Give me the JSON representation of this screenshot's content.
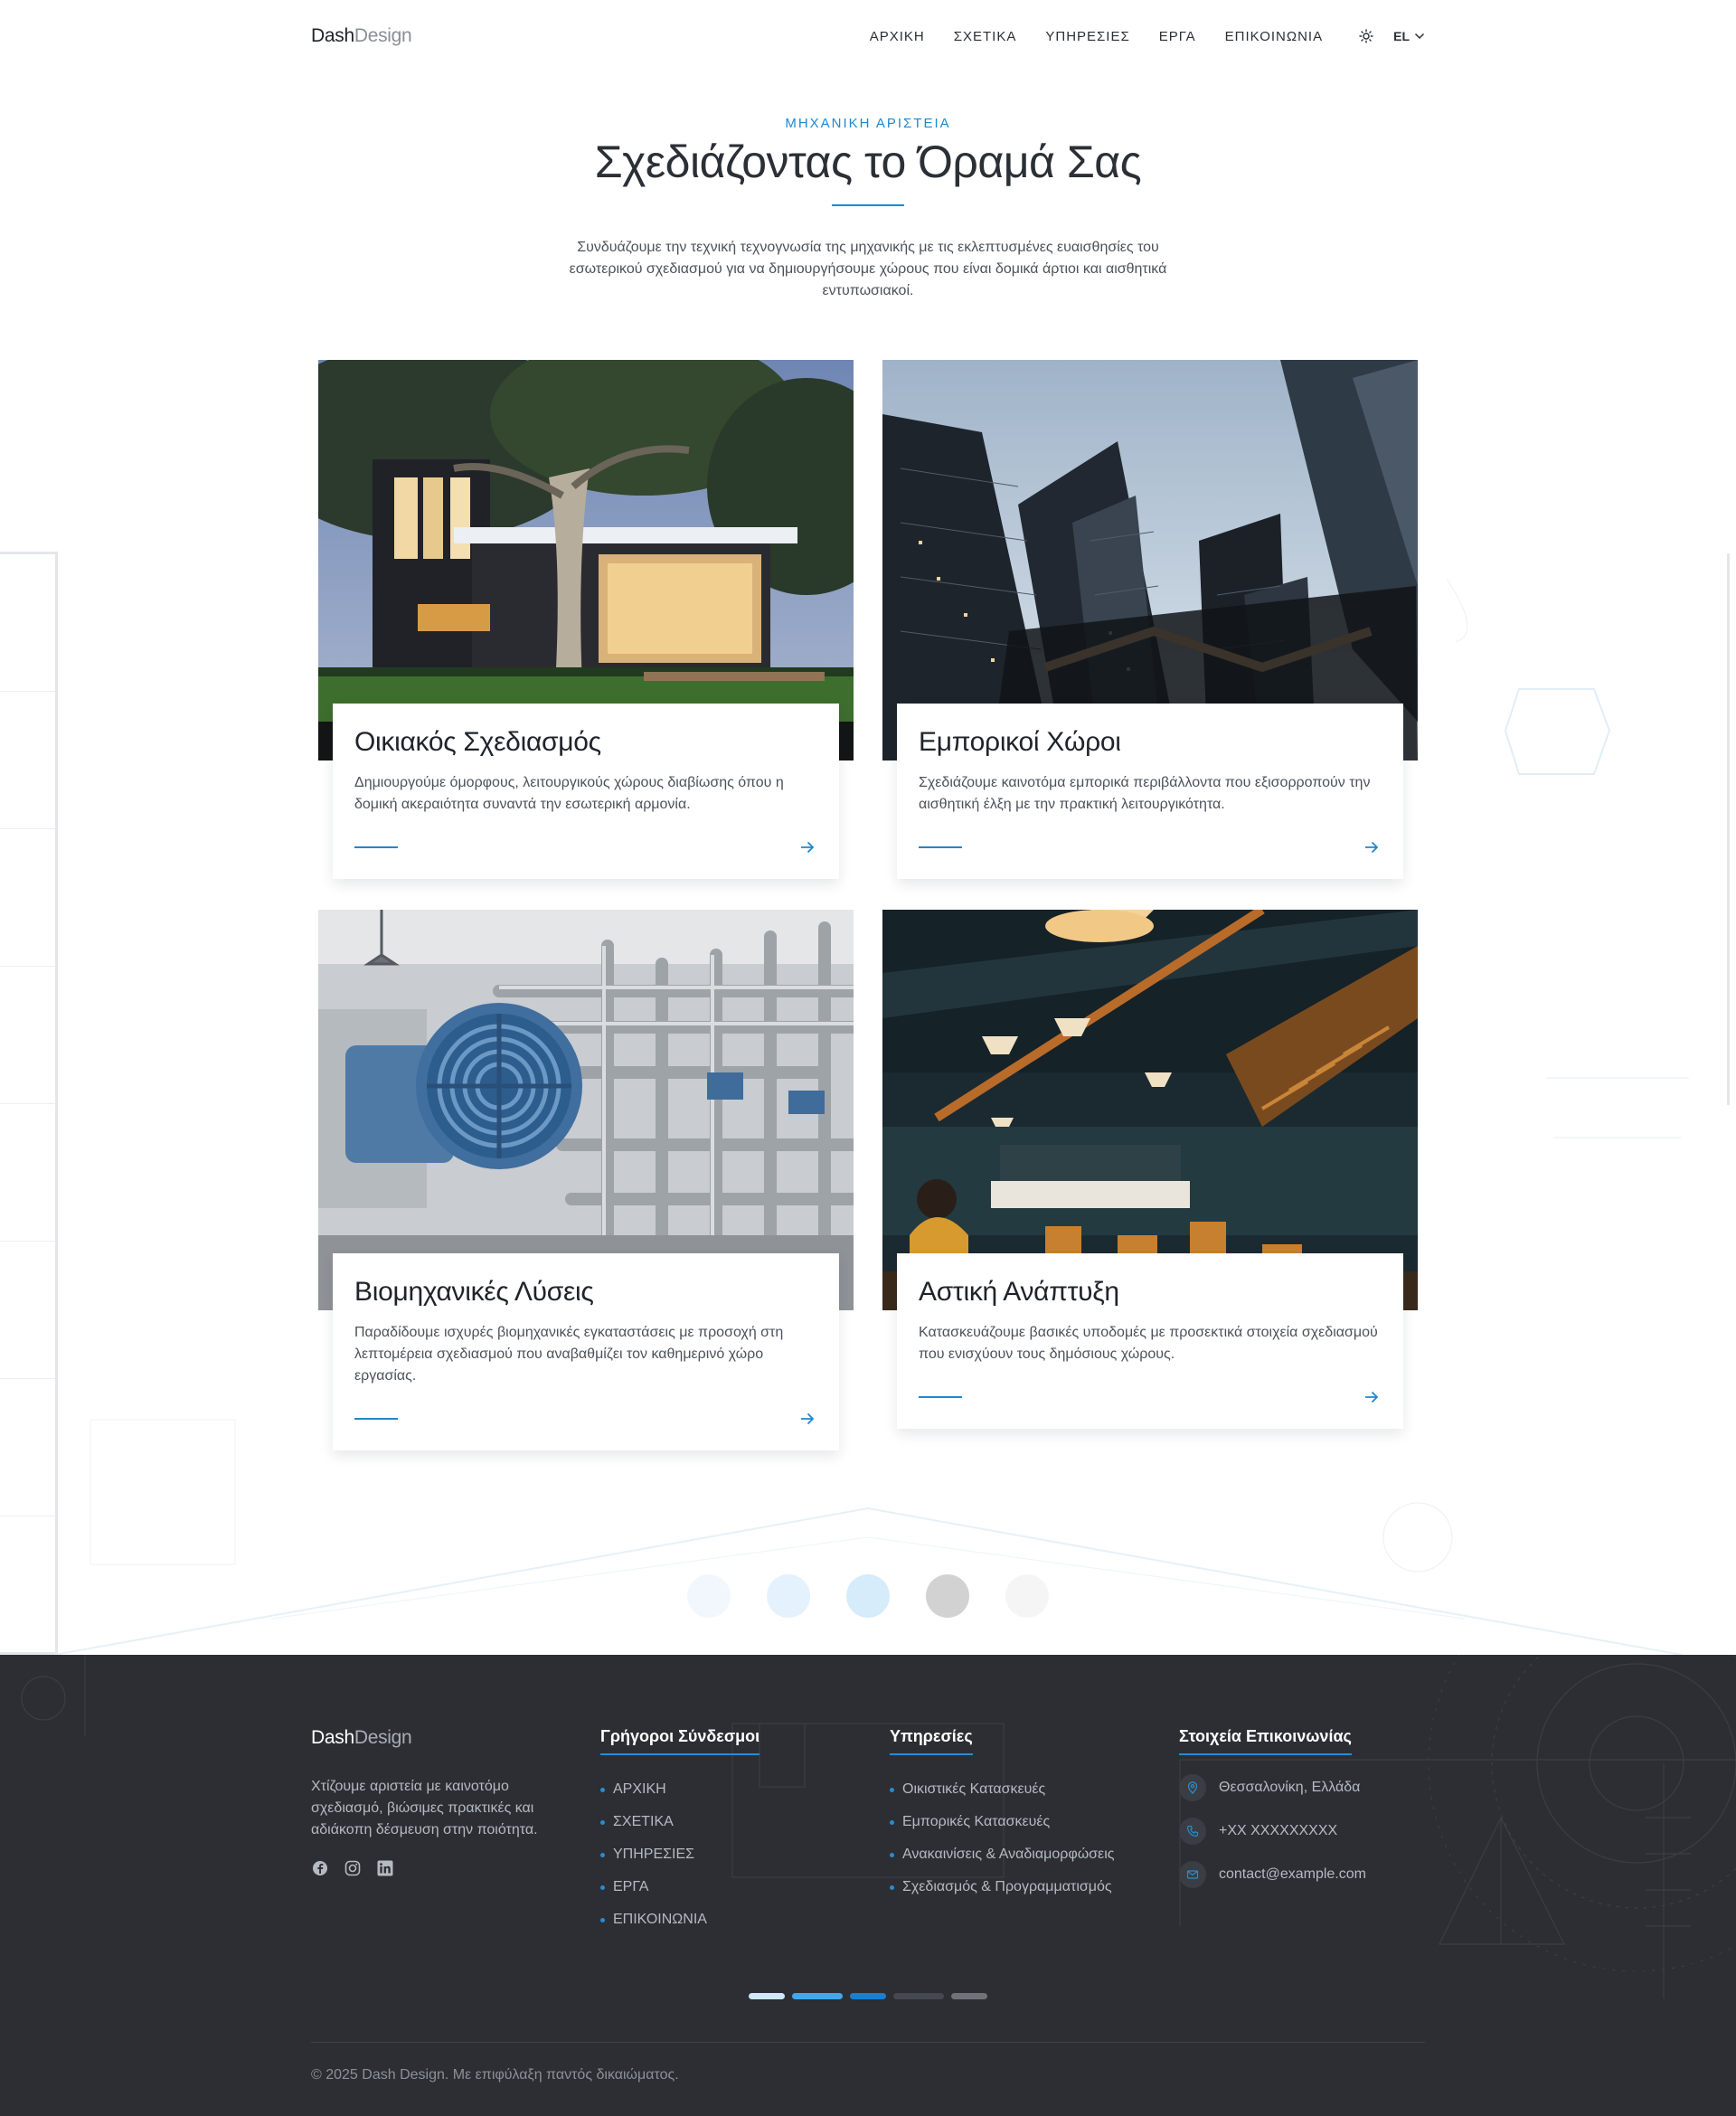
{
  "header": {
    "logo_bold": "Dash",
    "logo_light": "Design",
    "nav": [
      "ΑΡΧΙΚΗ",
      "ΣΧΕΤΙΚΑ",
      "ΥΠΗΡΕΣΙΕΣ",
      "ΕΡΓΑ",
      "ΕΠΙΚΟΙΝΩΝΙΑ"
    ],
    "language": "EL",
    "theme_icon": "sun-icon"
  },
  "hero": {
    "eyebrow": "ΜΗΧΑΝΙΚΗ ΑΡΙΣΤΕΙΑ",
    "title": "Σχεδιάζοντας το Όραμά Σας",
    "description": "Συνδυάζουμε την τεχνική τεχνογνωσία της μηχανικής με τις εκλεπτυσμένες ευαισθησίες του εσωτερικού σχεδιασμού για να δημιουργήσουμε χώρους που είναι δομικά άρτιοι και αισθητικά εντυπωσιακοί."
  },
  "services": [
    {
      "title": "Οικιακός Σχεδιασμός",
      "text": "Δημιουργούμε όμορφους, λειτουργικούς χώρους διαβίωσης όπου η δομική ακεραιότητα συναντά την εσωτερική αρμονία.",
      "image": "modern-house-photo"
    },
    {
      "title": "Εμπορικοί Χώροι",
      "text": "Σχεδιάζουμε καινοτόμα εμπορικά περιβάλλοντα που εξισορροπούν την αισθητική έλξη με την πρακτική λειτουργικότητα.",
      "image": "skyscrapers-photo"
    },
    {
      "title": "Βιομηχανικές Λύσεις",
      "text": "Παραδίδουμε ισχυρές βιομηχανικές εγκαταστάσεις με προσοχή στη λεπτομέρεια σχεδιασμού που αναβαθμίζει τον καθημερινό χώρο εργασίας.",
      "image": "industrial-pipes-photo"
    },
    {
      "title": "Αστική Ανάπτυξη",
      "text": "Κατασκευάζουμε βασικές υποδομές με προσεκτικά στοιχεία σχεδιασμού που ενισχύουν τους δημόσιους χώρους.",
      "image": "restaurant-interior-photo"
    }
  ],
  "carousel": {
    "dot_colors": [
      "#f1f7fd",
      "#e4f2fd",
      "#d6ecfb",
      "#d2d2d2",
      "#f5f5f5"
    ]
  },
  "footer": {
    "logo_bold": "Dash",
    "logo_light": "Design",
    "about": "Χτίζουμε αριστεία με καινοτόμο σχεδιασμό, βιώσιμες πρακτικές και αδιάκοπη δέσμευση στην ποιότητα.",
    "social_icons": [
      "facebook-icon",
      "instagram-icon",
      "linkedin-icon"
    ],
    "quick_links": {
      "heading": "Γρήγοροι Σύνδεσμοι",
      "items": [
        "ΑΡΧΙΚΗ",
        "ΣΧΕΤΙΚΑ",
        "ΥΠΗΡΕΣΙΕΣ",
        "ΕΡΓΑ",
        "ΕΠΙΚΟΙΝΩΝΙΑ"
      ]
    },
    "services": {
      "heading": "Υπηρεσίες",
      "items": [
        "Οικιστικές Κατασκευές",
        "Εμπορικές Κατασκευές",
        "Ανακαινίσεις & Αναδιαμορφώσεις",
        "Σχεδιασμός & Προγραμματισμός"
      ]
    },
    "contact": {
      "heading": "Στοιχεία Επικοινωνίας",
      "address": "Θεσσαλονίκη, Ελλάδα",
      "phone": "+XX XXXXXXXXX",
      "email": "contact@example.com"
    },
    "bar_colors": [
      "#cfe8fb",
      "#44a7ec",
      "#1a7fcf",
      "#45484e",
      "#6f7278"
    ],
    "copyright": "© 2025 Dash Design. Με επιφύλαξη παντός δικαιώματος."
  },
  "colors": {
    "accent": "#1e88d0",
    "footer_bg": "#2c2e33"
  }
}
